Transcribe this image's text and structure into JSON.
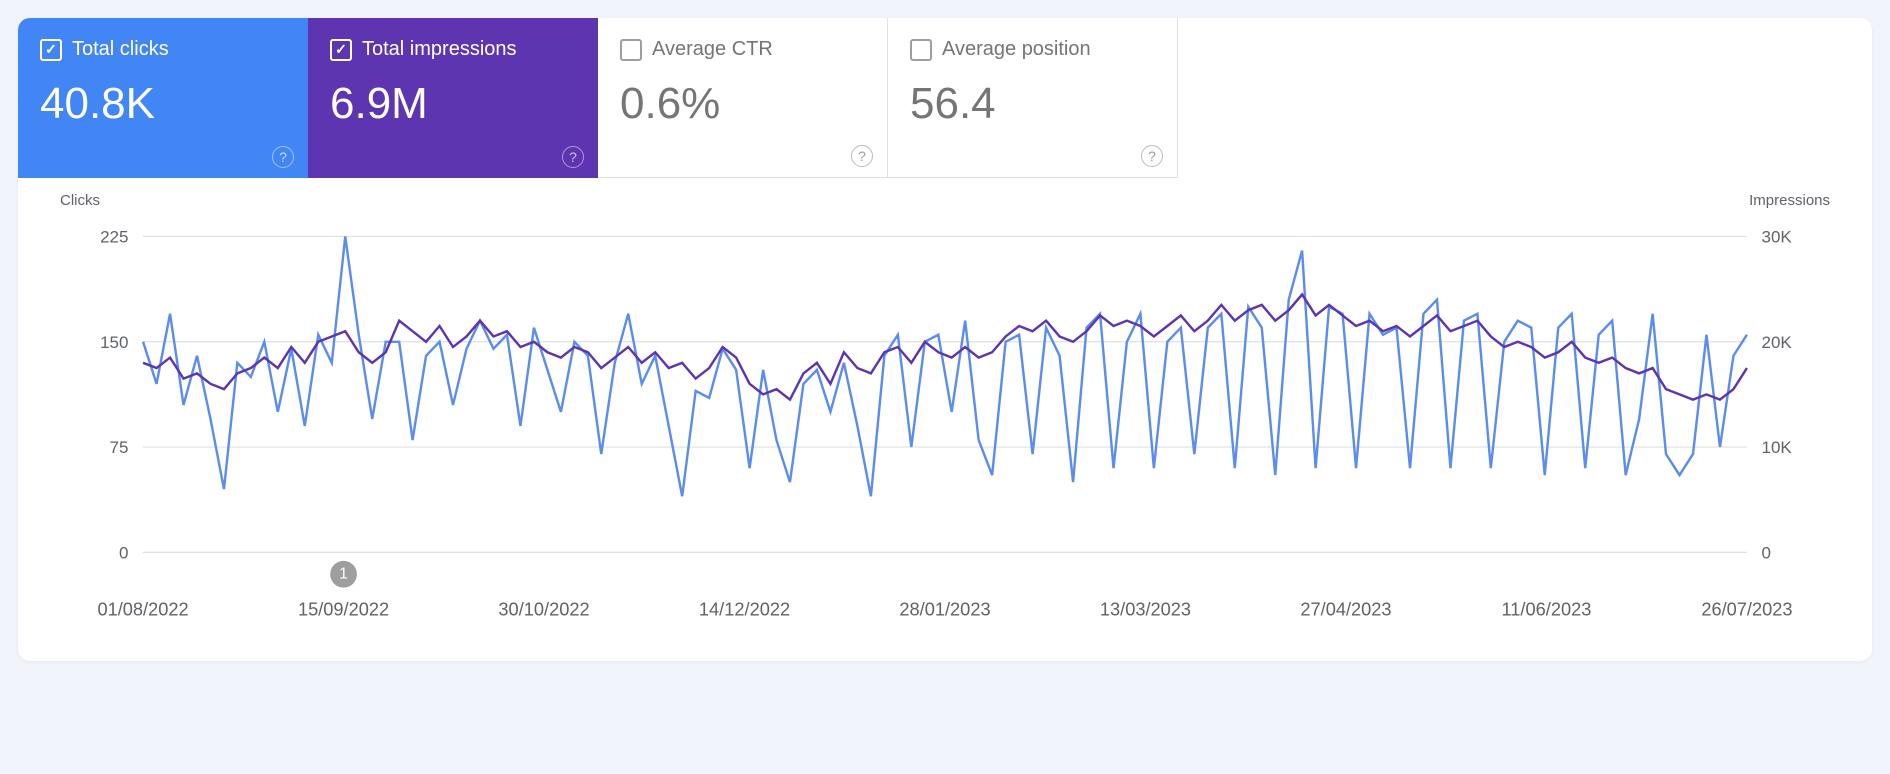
{
  "metrics": [
    {
      "id": "clicks",
      "label": "Total clicks",
      "value": "40.8K",
      "checked": true,
      "color": "blue"
    },
    {
      "id": "impr",
      "label": "Total impressions",
      "value": "6.9M",
      "checked": true,
      "color": "purple"
    },
    {
      "id": "ctr",
      "label": "Average CTR",
      "value": "0.6%",
      "checked": false,
      "color": "white"
    },
    {
      "id": "pos",
      "label": "Average position",
      "value": "56.4",
      "checked": false,
      "color": "white"
    }
  ],
  "axes": {
    "left_title": "Clicks",
    "right_title": "Impressions",
    "left_ticks": [
      "225",
      "150",
      "75",
      "0"
    ],
    "right_ticks": [
      "30K",
      "20K",
      "10K",
      "0"
    ],
    "x_ticks": [
      "01/08/2022",
      "15/09/2022",
      "30/10/2022",
      "14/12/2022",
      "28/01/2023",
      "13/03/2023",
      "27/04/2023",
      "11/06/2023",
      "26/07/2023"
    ]
  },
  "annotations": [
    {
      "id": "m1",
      "x_index": 1,
      "label": "1"
    }
  ],
  "chart_data": {
    "type": "line",
    "title": "",
    "xlabel": "",
    "ylabel_left": "Clicks",
    "ylabel_right": "Impressions",
    "ylim_left": [
      0,
      225
    ],
    "ylim_right": [
      0,
      30000
    ],
    "x": [
      0,
      1,
      2,
      3,
      4,
      5,
      6,
      7,
      8,
      9,
      10,
      11,
      12,
      13,
      14,
      15,
      16,
      17,
      18,
      19,
      20,
      21,
      22,
      23,
      24,
      25,
      26,
      27,
      28,
      29,
      30,
      31,
      32,
      33,
      34,
      35,
      36,
      37,
      38,
      39,
      40,
      41,
      42,
      43,
      44,
      45,
      46,
      47,
      48,
      49,
      50,
      51,
      52,
      53,
      54,
      55,
      56,
      57,
      58,
      59,
      60,
      61,
      62,
      63,
      64,
      65,
      66,
      67,
      68,
      69,
      70,
      71,
      72,
      73,
      74,
      75,
      76,
      77,
      78,
      79,
      80,
      81,
      82,
      83,
      84,
      85,
      86,
      87,
      88,
      89,
      90,
      91,
      92,
      93,
      94,
      95,
      96,
      97,
      98,
      99,
      100,
      101,
      102,
      103,
      104,
      105,
      106,
      107,
      108,
      109,
      110,
      111,
      112,
      113,
      114,
      115,
      116,
      117,
      118,
      119
    ],
    "x_tick_labels": [
      "01/08/2022",
      "15/09/2022",
      "30/10/2022",
      "14/12/2022",
      "28/01/2023",
      "13/03/2023",
      "27/04/2023",
      "11/06/2023",
      "26/07/2023"
    ],
    "series": [
      {
        "name": "Clicks",
        "axis": "left",
        "color": "#5b8def",
        "values": [
          150,
          120,
          170,
          105,
          140,
          95,
          45,
          135,
          125,
          150,
          100,
          145,
          90,
          155,
          135,
          225,
          155,
          95,
          150,
          150,
          80,
          140,
          150,
          105,
          145,
          165,
          145,
          155,
          90,
          160,
          130,
          100,
          150,
          140,
          70,
          135,
          170,
          120,
          140,
          90,
          40,
          115,
          110,
          145,
          130,
          60,
          130,
          80,
          50,
          120,
          130,
          100,
          135,
          90,
          40,
          140,
          155,
          75,
          150,
          155,
          100,
          165,
          80,
          55,
          150,
          155,
          70,
          160,
          140,
          50,
          160,
          170,
          60,
          150,
          170,
          60,
          150,
          160,
          70,
          160,
          170,
          60,
          175,
          160,
          55,
          180,
          215,
          60,
          175,
          170,
          60,
          170,
          155,
          160,
          60,
          170,
          180,
          60,
          165,
          170,
          60,
          150,
          165,
          160,
          55,
          160,
          170,
          60,
          155,
          165,
          55,
          95,
          170,
          70,
          55,
          70,
          155,
          75,
          140,
          155
        ]
      },
      {
        "name": "Impressions",
        "axis": "right",
        "color": "#5e35b1",
        "values": [
          18000,
          17500,
          18500,
          16500,
          17000,
          16000,
          15500,
          17000,
          17500,
          18500,
          17500,
          19500,
          18000,
          20000,
          20500,
          21000,
          19000,
          18000,
          19000,
          22000,
          21000,
          20000,
          21500,
          19500,
          20500,
          22000,
          20500,
          21000,
          19500,
          20000,
          19000,
          18500,
          19500,
          19000,
          17500,
          18500,
          19500,
          18000,
          19000,
          17500,
          18000,
          16500,
          17500,
          19500,
          18500,
          16000,
          15000,
          15500,
          14500,
          17000,
          18000,
          16000,
          19000,
          17500,
          17000,
          19000,
          19500,
          18000,
          20000,
          19000,
          18500,
          19500,
          18500,
          19000,
          20500,
          21500,
          21000,
          22000,
          20500,
          20000,
          21000,
          22500,
          21500,
          22000,
          21500,
          20500,
          21500,
          22500,
          21000,
          22000,
          23500,
          22000,
          23000,
          23500,
          22000,
          23000,
          24500,
          22500,
          23500,
          22500,
          21500,
          22000,
          21000,
          21500,
          20500,
          21500,
          22500,
          21000,
          21500,
          22000,
          20500,
          19500,
          20000,
          19500,
          18500,
          19000,
          20000,
          18500,
          18000,
          18500,
          17500,
          17000,
          17500,
          15500,
          15000,
          14500,
          15000,
          14500,
          15500,
          17500
        ]
      }
    ]
  }
}
